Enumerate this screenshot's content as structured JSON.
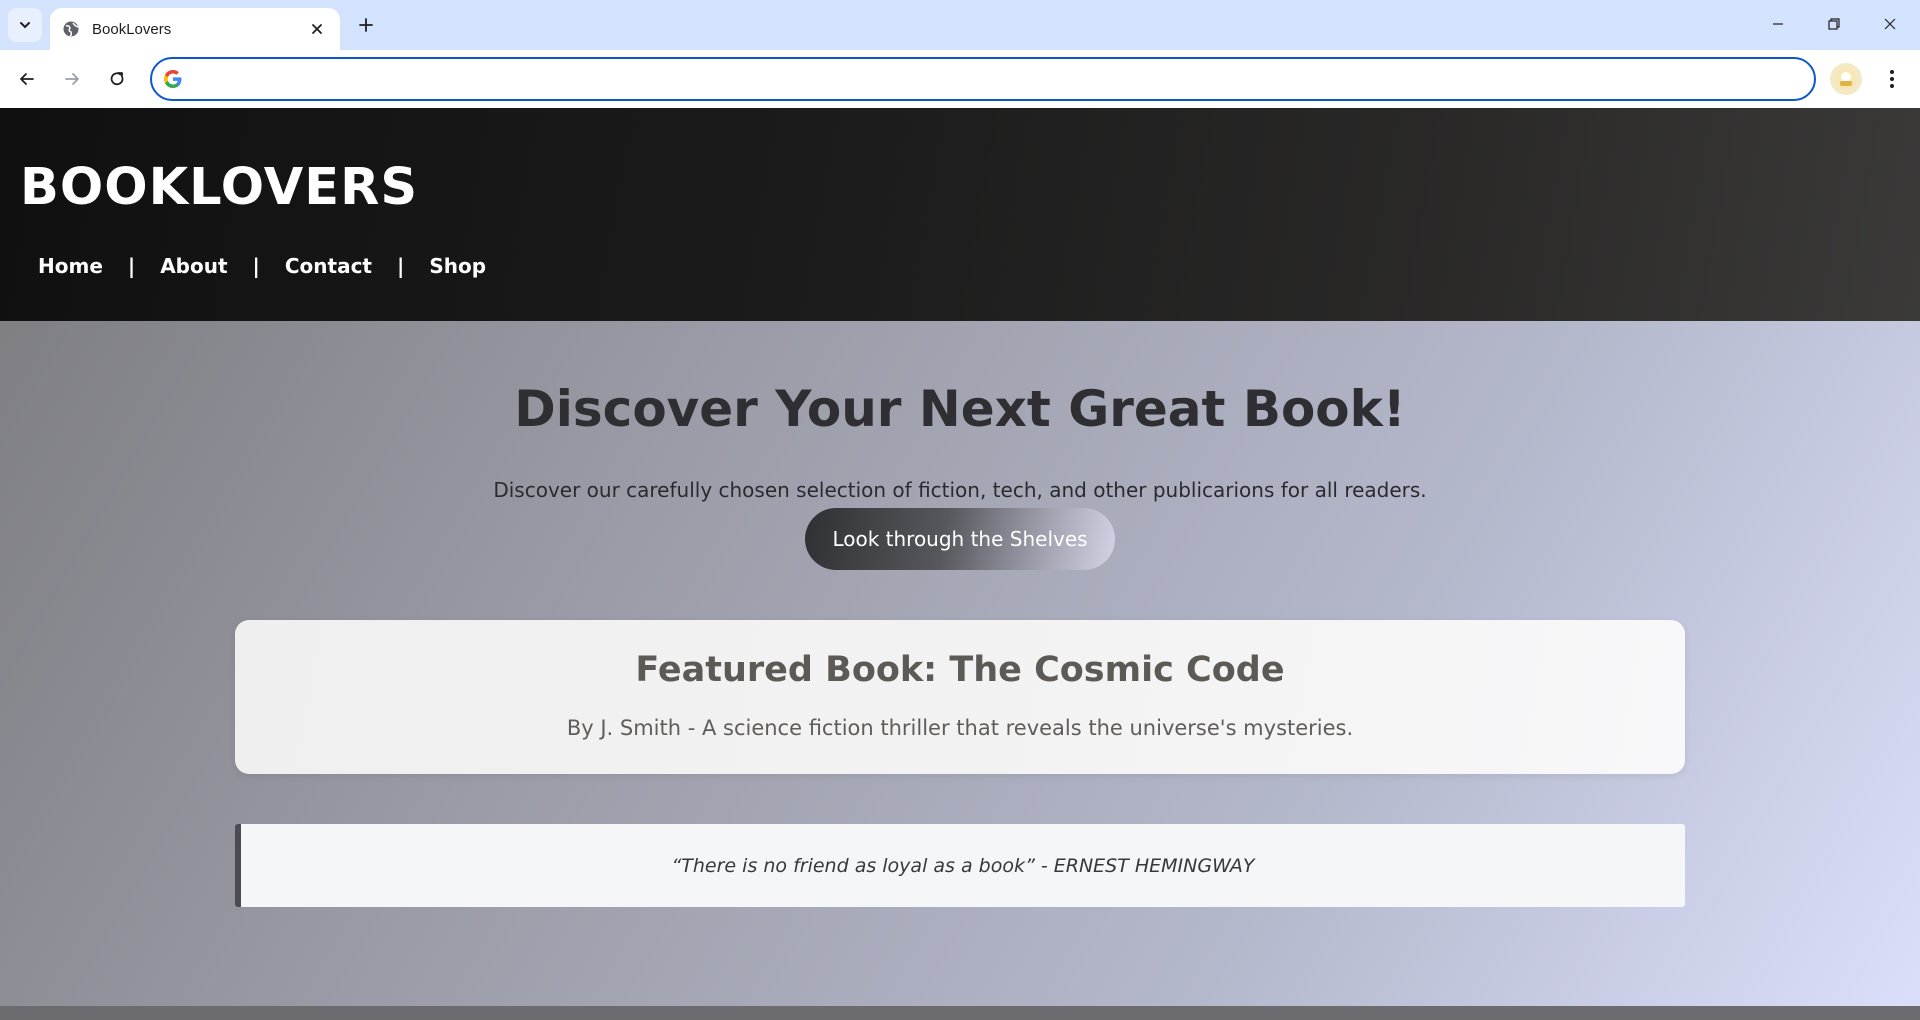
{
  "browser": {
    "tab_title": "BookLovers",
    "omnibox_value": "",
    "omnibox_placeholder": ""
  },
  "site": {
    "logo": "BOOKLOVERS",
    "nav": [
      {
        "label": "Home"
      },
      {
        "label": "About"
      },
      {
        "label": "Contact"
      },
      {
        "label": "Shop"
      }
    ],
    "nav_separator": "|"
  },
  "hero": {
    "title": "Discover Your Next Great Book!",
    "subtitle": "Discover our carefully chosen selection of fiction, tech, and other publicarions for all readers.",
    "cta_label": "Look through the Shelves"
  },
  "featured": {
    "title": "Featured Book: The Cosmic Code",
    "description": "By J. Smith - A science fiction thriller that reveals the universe's mysteries."
  },
  "quote": {
    "text": "“There is no friend as loyal as a book” - ERNEST HEMINGWAY"
  },
  "colors": {
    "omnibox_focus": "#0b57d0",
    "tabbar_bg": "#d3e3fd",
    "header_dark": "#101010",
    "hero_text": "#2f2f33"
  },
  "icons": {
    "tab_list": "chevron-down-icon",
    "favicon": "globe-icon",
    "tab_close": "close-icon",
    "new_tab": "plus-icon",
    "back": "arrow-left-icon",
    "forward": "arrow-right-icon",
    "reload": "reload-icon",
    "search_engine": "google-icon",
    "profile": "avatar-icon",
    "menu": "kebab-menu-icon"
  }
}
